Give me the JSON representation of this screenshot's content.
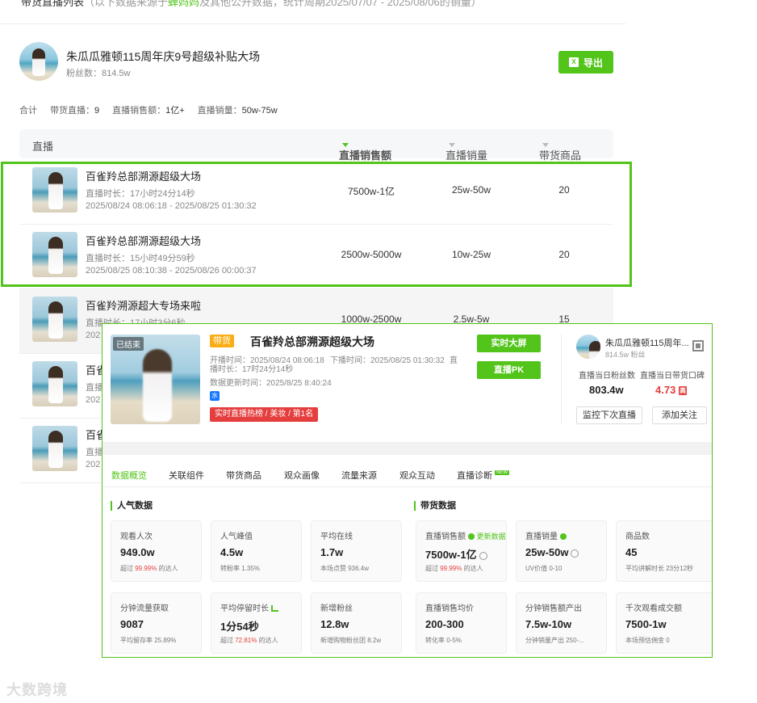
{
  "header": {
    "prefix": "带货直播列表",
    "note_a": "（以下数据来源于",
    "note_b": "蝉妈妈",
    "note_c": "及其他公开数据，统计周期2025/07/07 - 2025/08/06的销量）"
  },
  "anchor": {
    "name": "朱瓜瓜雅顿115周年庆9号超级补贴大场",
    "fans": "粉丝数：814.5w",
    "export_label": "导出",
    "export_icon": "excel-icon"
  },
  "summary": {
    "total": "合计",
    "lives_label": "带货直播：",
    "lives_value": "9",
    "sales_label": "直播销售额：",
    "sales_value": "1亿+",
    "volume_label": "直播销量：",
    "volume_value": "50w-75w"
  },
  "table": {
    "headers": {
      "live": "直播",
      "sales": "直播销售额",
      "volume": "直播销量",
      "goods": "带货商品"
    },
    "rows": [
      {
        "title": "百雀羚总部溯源超级大场",
        "duration": "直播时长：17小时24分14秒",
        "time": "2025/08/24 08:06:18 - 2025/08/25 01:30:32",
        "sales": "7500w-1亿",
        "volume": "25w-50w",
        "goods": "20"
      },
      {
        "title": "百雀羚总部溯源超级大场",
        "duration": "直播时长：15小时49分59秒",
        "time": "2025/08/25 08:10:38 - 2025/08/26 00:00:37",
        "sales": "2500w-5000w",
        "volume": "10w-25w",
        "goods": "20"
      },
      {
        "title": "百雀羚溯源超大专场来啦",
        "duration": "直播时长：17小时3分6秒",
        "time": "202",
        "sales": "1000w-2500w",
        "volume": "2.5w-5w",
        "goods": "15"
      },
      {
        "title": "百雀",
        "duration": "直播",
        "time": "202",
        "sales": "",
        "volume": "",
        "goods": ""
      },
      {
        "title": "百雀",
        "duration": "直播",
        "time": "202",
        "sales": "",
        "volume": "",
        "goods": ""
      }
    ]
  },
  "popup": {
    "ended_tag": "已结束",
    "cart_tag": "带货",
    "title": "百雀羚总部溯源超级大场",
    "start": "开播时间：2025/08/24 08:06:18",
    "end": "下播时间：2025/08/25 01:30:32",
    "live_label": "直",
    "duration": "播时长：17时24分14秒",
    "update": "数据更新时间：2025/8/25 8:40:24",
    "blue_badge": "水",
    "hot": "实时直播热榜 / 美妆 / 第1名",
    "btn_screen": "实时大屏",
    "btn_pk": "直播PK",
    "anchor_name": "朱瓜瓜雅顿115周年...",
    "anchor_fans": "814.5w 粉丝",
    "stat1_label": "直播当日粉丝数",
    "stat1_value": "803.4w",
    "stat2_label": "直播当日带货口碑",
    "stat2_value": "4.73",
    "stat2_badge": "高",
    "btn_monitor": "监控下次直播",
    "btn_follow": "添加关注",
    "tabs": [
      "数据概览",
      "关联组件",
      "带货商品",
      "观众画像",
      "流量来源",
      "观众互动",
      "直播诊断"
    ],
    "new_badge": "NEW",
    "sec_pop": "人气数据",
    "sec_goods": "带货数据",
    "update_text": "更新数据",
    "cards": [
      {
        "label": "观看人次",
        "value": "949.0w",
        "sub_a": "超过 ",
        "sub_b": "99.99%",
        "sub_c": " 的达人"
      },
      {
        "label": "人气峰值",
        "value": "4.5w",
        "sub_a": "转粉率 1.35%",
        "sub_b": "",
        "sub_c": ""
      },
      {
        "label": "平均在线",
        "value": "1.7w",
        "sub_a": "本场点赞 936.4w",
        "sub_b": "",
        "sub_c": ""
      },
      {
        "label": "直播销售额",
        "value": "7500w-1亿",
        "sub_a": "超过 ",
        "sub_b": "99.99%",
        "sub_c": " 的达人"
      },
      {
        "label": "直播销量",
        "value": "25w-50w",
        "sub_a": "UV价值 0-10",
        "sub_b": "",
        "sub_c": ""
      },
      {
        "label": "商品数",
        "value": "45",
        "sub_a": "平均讲解时长 23分12秒",
        "sub_b": "",
        "sub_c": ""
      },
      {
        "label": "分钟流量获取",
        "value": "9087",
        "sub_a": "平均留存率 25.89%",
        "sub_b": "",
        "sub_c": ""
      },
      {
        "label": "平均停留时长",
        "value": "1分54秒",
        "sub_a": "超过 ",
        "sub_b": "72.81%",
        "sub_c": " 的达人"
      },
      {
        "label": "新增粉丝",
        "value": "12.8w",
        "sub_a": "新增购物粉丝团 8.2w",
        "sub_b": "",
        "sub_c": ""
      },
      {
        "label": "直播销售均价",
        "value": "200-300",
        "sub_a": "转化率 0-5%",
        "sub_b": "",
        "sub_c": ""
      },
      {
        "label": "分钟销售额产出",
        "value": "7.5w-10w",
        "sub_a": "分钟销量产出 250-...",
        "sub_b": "",
        "sub_c": ""
      },
      {
        "label": "千次观看成交额",
        "value": "7500-1w",
        "sub_a": "本场预估佣金 0",
        "sub_b": "",
        "sub_c": ""
      }
    ]
  },
  "watermark": "大数跨境",
  "colors": {
    "accent": "#52c41a",
    "red": "#e53e3e",
    "orange": "#faad14"
  }
}
